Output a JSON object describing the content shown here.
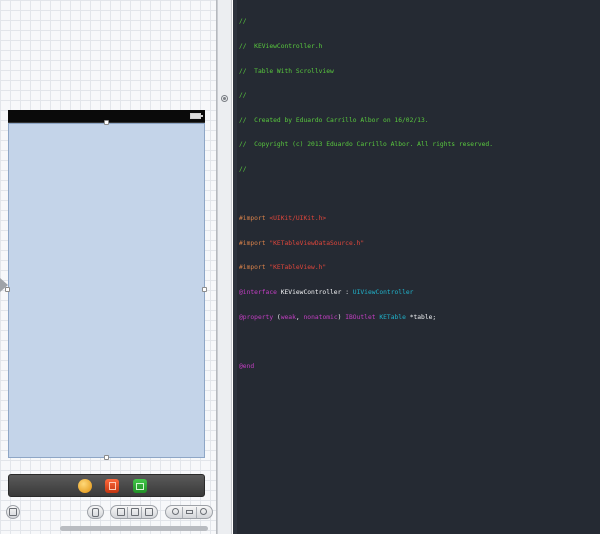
{
  "code": {
    "header_comment": [
      "//",
      "//  KEViewController.h",
      "//  Table With Scrollview",
      "//",
      "//  Created by Eduardo Carrillo Albor on 16/02/13.",
      "//  Copyright (c) 2013 Eduardo Carrillo Albor. All rights reserved.",
      "//"
    ],
    "import_directive": "#import",
    "import_uikit": "<UIKit/UIKit.h>",
    "import_datasource": "\"KETableViewDataSource.h\"",
    "import_tableview": "\"KETableView.h\"",
    "interface_keyword": "@interface",
    "class_name": "KEViewController",
    "colon": ":",
    "superclass": "UIViewController",
    "property_keyword": "@property",
    "open_paren": "(",
    "attr_weak": "weak",
    "comma": ",",
    "attr_nonatomic": "nonatomic",
    "close_paren": ")",
    "outlet_keyword": "IBOutlet",
    "property_type": "KETable",
    "property_name": "*table;",
    "end_keyword": "@end"
  },
  "colors": {
    "editor_background": "#252a33",
    "comment": "#59c93e",
    "preprocessor": "#d9824a",
    "string": "#e0463b",
    "keyword": "#c33ec3",
    "class": "#20b3cb",
    "view_background": "#c4d4e9"
  },
  "icons": {
    "scene_dock": [
      "first-responder-icon",
      "cube-icon",
      "exit-icon"
    ],
    "canvas_toolbar": [
      "hide-outline-icon",
      "form-factor-icon",
      "align-icon",
      "pin-icon",
      "resize-icon",
      "zoom-out-icon",
      "zoom-actual-icon",
      "zoom-in-icon"
    ]
  }
}
